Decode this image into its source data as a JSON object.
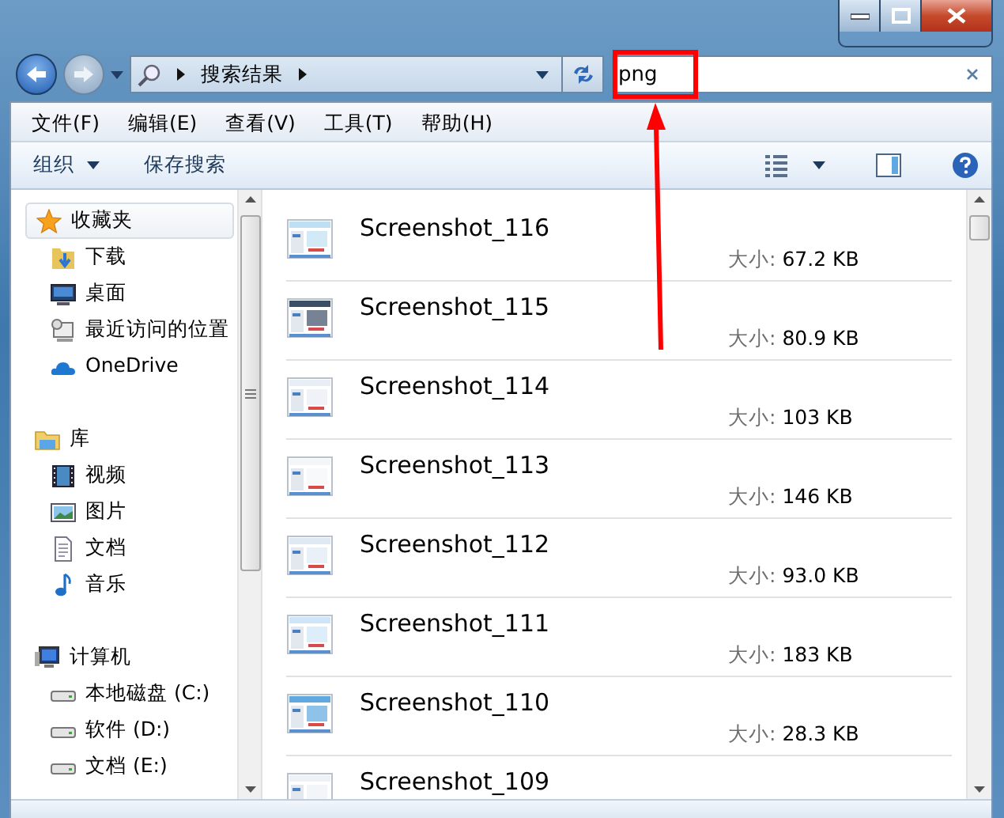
{
  "address": {
    "crumbs": [
      "搜索结果"
    ]
  },
  "search": {
    "value": "png"
  },
  "menu": [
    "文件(F)",
    "编辑(E)",
    "查看(V)",
    "工具(T)",
    "帮助(H)"
  ],
  "toolbar": {
    "organize": "组织",
    "save_search": "保存搜索"
  },
  "nav": [
    {
      "label": "收藏夹",
      "kind": "star",
      "selected": true,
      "children": [
        {
          "label": "下载",
          "kind": "downloads",
          "selected": false
        },
        {
          "label": "桌面",
          "kind": "desktop",
          "selected": false
        },
        {
          "label": "最近访问的位置",
          "kind": "recent",
          "selected": false
        },
        {
          "label": "OneDrive",
          "kind": "cloud",
          "selected": false
        }
      ]
    },
    {
      "label": "库",
      "kind": "library",
      "selected": false,
      "children": [
        {
          "label": "视频",
          "kind": "video",
          "selected": false
        },
        {
          "label": "图片",
          "kind": "pictures",
          "selected": false
        },
        {
          "label": "文档",
          "kind": "documents",
          "selected": false
        },
        {
          "label": "音乐",
          "kind": "music",
          "selected": false
        }
      ]
    },
    {
      "label": "计算机",
      "kind": "computer",
      "selected": false,
      "children": [
        {
          "label": "本地磁盘 (C:)",
          "kind": "drive",
          "selected": false
        },
        {
          "label": "软件 (D:)",
          "kind": "drive",
          "selected": false
        },
        {
          "label": "文档 (E:)",
          "kind": "drive",
          "selected": false
        }
      ]
    }
  ],
  "files": [
    {
      "name": "Screenshot_116",
      "size_label": "大小:",
      "size": "67.2 KB"
    },
    {
      "name": "Screenshot_115",
      "size_label": "大小:",
      "size": "80.9 KB"
    },
    {
      "name": "Screenshot_114",
      "size_label": "大小:",
      "size": "103 KB"
    },
    {
      "name": "Screenshot_113",
      "size_label": "大小:",
      "size": "146 KB"
    },
    {
      "name": "Screenshot_112",
      "size_label": "大小:",
      "size": "93.0 KB"
    },
    {
      "name": "Screenshot_111",
      "size_label": "大小:",
      "size": "183 KB"
    },
    {
      "name": "Screenshot_110",
      "size_label": "大小:",
      "size": "28.3 KB"
    },
    {
      "name": "Screenshot_109"
    }
  ]
}
